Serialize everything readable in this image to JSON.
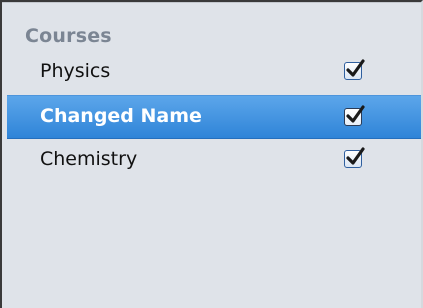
{
  "sidebar": {
    "section_header": "Courses",
    "items": [
      {
        "label": "Physics",
        "checked": true,
        "selected": false
      },
      {
        "label": "Changed Name",
        "checked": true,
        "selected": true
      },
      {
        "label": "Chemistry",
        "checked": true,
        "selected": false
      }
    ]
  },
  "colors": {
    "background": "#dfe3e9",
    "section_header": "#7b8593",
    "selection": "#3d8fe0",
    "checkmark": "#1a1a1a"
  },
  "icons": {
    "checkbox": "checkmark-icon"
  }
}
